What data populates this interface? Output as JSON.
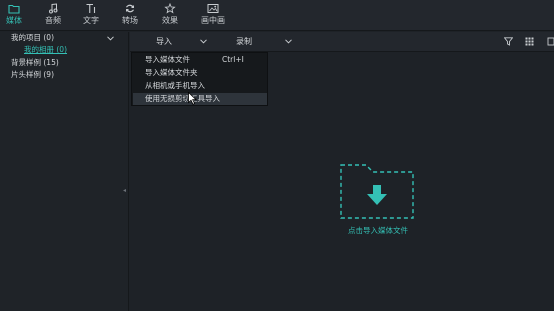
{
  "toolbar": {
    "tabs": [
      {
        "label": "媒体",
        "icon": "folder-icon"
      },
      {
        "label": "音频",
        "icon": "music-note-icon"
      },
      {
        "label": "文字",
        "icon": "text-icon"
      },
      {
        "label": "转场",
        "icon": "transition-icon"
      },
      {
        "label": "效果",
        "icon": "effects-icon"
      },
      {
        "label": "画中画",
        "icon": "picture-in-picture-icon"
      }
    ],
    "active_tab": "媒体"
  },
  "sidebar": {
    "items": [
      {
        "label": "我的项目 (0)"
      },
      {
        "label": "我的相册 (0)"
      },
      {
        "label": "背景样例 (15)"
      },
      {
        "label": "片头样例 (9)"
      }
    ]
  },
  "mainbar": {
    "import_label": "导入",
    "record_label": "录制"
  },
  "import_menu": {
    "items": [
      {
        "label": "导入媒体文件",
        "shortcut": "Ctrl+I"
      },
      {
        "label": "导入媒体文件夹",
        "shortcut": ""
      },
      {
        "label": "从相机或手机导入",
        "shortcut": ""
      },
      {
        "label": "使用无损剪切工具导入",
        "shortcut": ""
      }
    ],
    "highlighted_index": 3
  },
  "dropzone": {
    "label": "点击导入媒体文件"
  },
  "colors": {
    "accent": "#34c0b5",
    "background": "#1e2227",
    "toolbar": "#23272d",
    "menu": "#16191c"
  }
}
